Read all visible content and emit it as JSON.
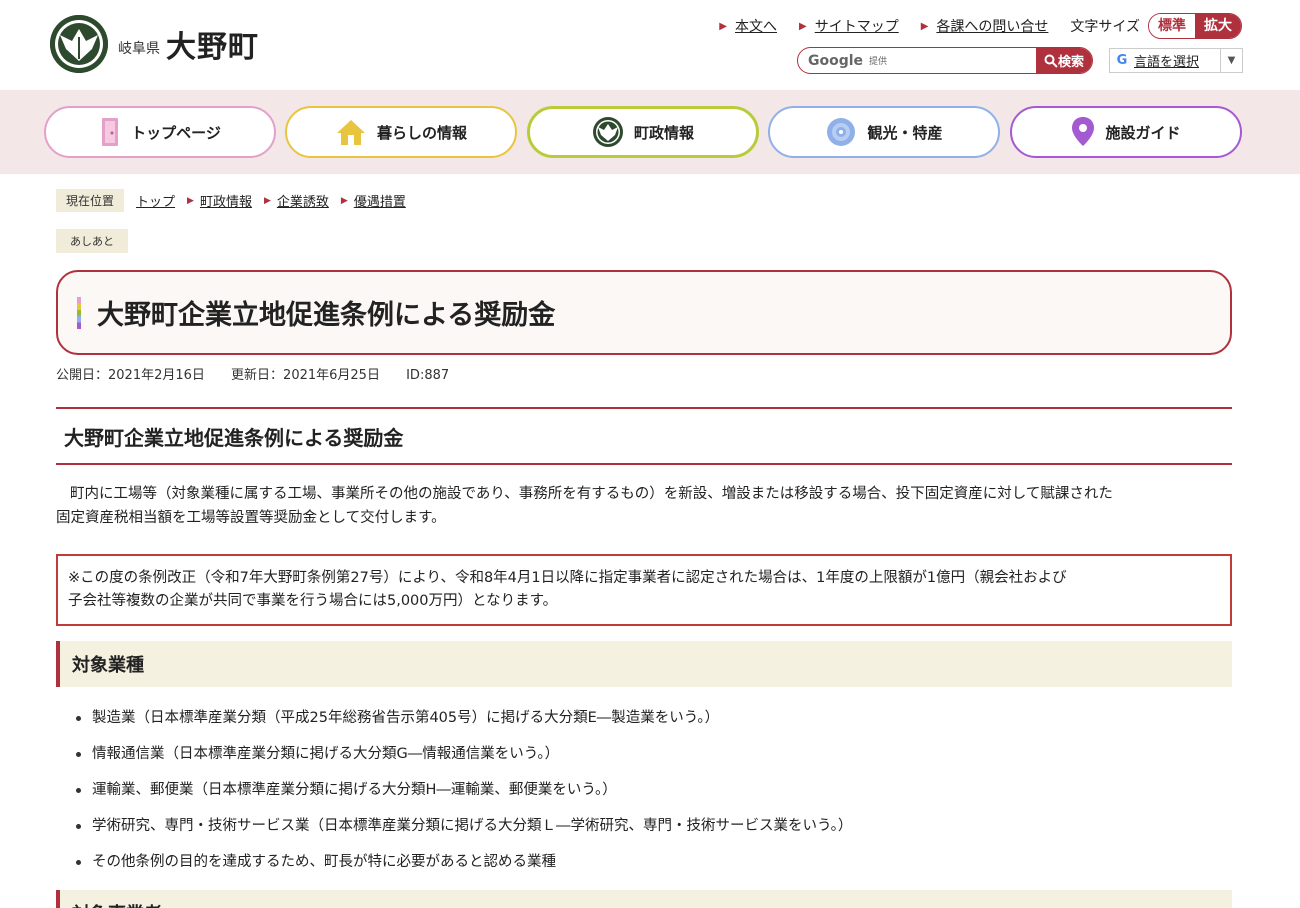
{
  "header": {
    "pref": "岐阜県",
    "town": "大野町",
    "links": [
      "本文へ",
      "サイトマップ",
      "各課への問い合せ"
    ],
    "font_size_label": "文字サイズ",
    "font_std": "標準",
    "font_big": "拡大",
    "search_placeholder_brand": "Google",
    "search_placeholder_sub": "提供",
    "search_button": "検索",
    "lang_label": "言語を選択"
  },
  "nav": [
    "トップページ",
    "暮らしの情報",
    "町政情報",
    "観光・特産",
    "施設ガイド"
  ],
  "breadcrumb": {
    "here": "現在位置",
    "items": [
      "トップ",
      "町政情報",
      "企業誘致",
      "優遇措置"
    ]
  },
  "ashiato": "あしあと",
  "page": {
    "title": "大野町企業立地促進条例による奨励金",
    "published": "公開日：2021年2月16日",
    "updated": "更新日：2021年6月25日",
    "id": "ID:887",
    "h2": "大野町企業立地促進条例による奨励金",
    "intro_line1": "町内に工場等（対象業種に属する工場、事業所その他の施設であり、事務所を有するもの）を新設、増設または移設する場合、投下固定資産に対して賦課された",
    "intro_line2": "固定資産税相当額を工場等設置等奨励金として交付します。",
    "notice_line1": "※この度の条例改正（令和7年大野町条例第27号）により、令和8年4月1日以降に指定事業者に認定された場合は、1年度の上限額が1億円（親会社および",
    "notice_line2": "子会社等複数の企業が共同で事業を行う場合には5,000万円）となります。",
    "section1": "対象業種",
    "industries": [
      "製造業（日本標準産業分類（平成25年総務省告示第405号）に掲げる大分類E―製造業をいう。）",
      "情報通信業（日本標準産業分類に掲げる大分類G―情報通信業をいう。）",
      "運輸業、郵便業（日本標準産業分類に掲げる大分類H―運輸業、郵便業をいう。）",
      "学術研究、専門・技術サービス業（日本標準産業分類に掲げる大分類Ｌ―学術研究、専門・技術サービス業をいう。）",
      "その他条例の目的を達成するため、町長が特に必要があると認める業種"
    ],
    "section2": "対象事業者"
  },
  "colors": {
    "accent": "#b0313e",
    "nav_bg": "#f3e7e7",
    "nav_borders": [
      "#e5a0c8",
      "#e8c540",
      "#9ab73a",
      "#8fb0e8",
      "#a45ad0"
    ]
  }
}
